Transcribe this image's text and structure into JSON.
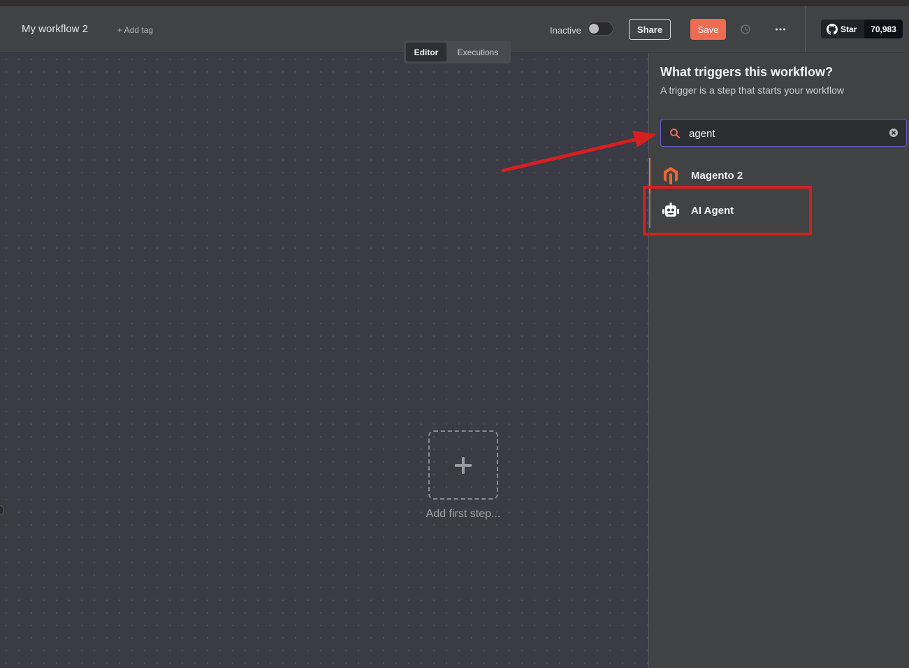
{
  "header": {
    "workflow_title": "My workflow 2",
    "add_tag": "+ Add tag",
    "status_label": "Inactive",
    "share_label": "Share",
    "save_label": "Save",
    "github": {
      "star_label": "Star",
      "star_count": "70,983"
    }
  },
  "tabs": [
    {
      "label": "Editor",
      "active": true
    },
    {
      "label": "Executions",
      "active": false
    }
  ],
  "canvas": {
    "add_first_step": "Add first step..."
  },
  "trigger_panel": {
    "title": "What triggers this workflow?",
    "subtitle": "A trigger is a step that starts your workflow",
    "search_value": "agent",
    "results": [
      {
        "label": "Magento 2",
        "icon": "magento-icon"
      },
      {
        "label": "AI Agent",
        "icon": "robot-icon"
      }
    ]
  },
  "colors": {
    "accent": "#ef6b52",
    "search_border": "#6e5fcf",
    "annotation": "#d42020"
  }
}
